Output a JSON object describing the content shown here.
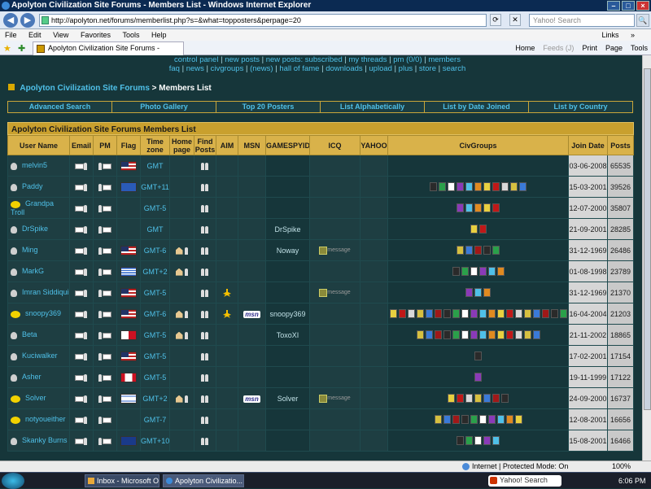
{
  "window": {
    "title": "Apolyton Civilization Site Forums - Members List - Windows Internet Explorer",
    "controls": {
      "minimize": "–",
      "maximize": "□",
      "close": "×"
    }
  },
  "addressbar": {
    "back": "◀",
    "forward": "▶",
    "url": "http://apolyton.net/forums/memberlist.php?s=&what=topposters&perpage=20",
    "refresh": "⟳",
    "stop": "✕",
    "search_placeholder": "Yahoo! Search",
    "search_go": "🔍"
  },
  "menubar": {
    "items": [
      "File",
      "Edit",
      "View",
      "Favorites",
      "Tools",
      "Help"
    ],
    "links": "Links",
    "links_arrow": "»"
  },
  "favbar": {
    "fav_star": "★",
    "add_fav": "✚",
    "tab_title": "Apolyton Civilization Site Forums - Members List",
    "tools": [
      "Home",
      "Feeds (J)",
      "Print",
      "Page",
      "Tools"
    ]
  },
  "forum": {
    "top_links_row1": [
      "control panel",
      "new posts",
      "new posts: subscribed",
      "my threads",
      "pm (0/0)",
      "members"
    ],
    "top_links_row2": [
      "faq",
      "news",
      "civgroups",
      "(news)",
      "hall of fame",
      "downloads",
      "upload",
      "plus",
      "store",
      "search"
    ],
    "breadcrumb_site": "Apolyton Civilization Site Forums",
    "breadcrumb_sep": ">",
    "breadcrumb_page": "Members List",
    "subnav": [
      "Advanced Search",
      "Photo Gallery",
      "Top 20 Posters",
      "List Alphabetically",
      "List by Date Joined",
      "List by Country"
    ],
    "table_title": "Apolyton Civilization Site Forums Members List",
    "columns": [
      "User Name",
      "Email",
      "PM",
      "Flag",
      "Time zone",
      "Home page",
      "Find Posts",
      "AIM",
      "MSN",
      "GAMESPYID",
      "ICQ",
      "YAHOO",
      "CivGroups",
      "Join Date",
      "Posts"
    ],
    "msn_label": "msn",
    "icq_label": "message",
    "members": [
      {
        "name": "melvin5",
        "bulb": "grey",
        "flag": "us",
        "tz": "GMT",
        "home": false,
        "aim": false,
        "msn": false,
        "gamespy": "",
        "icq": false,
        "civ": 0,
        "join": "03-06-2008",
        "posts": "65535"
      },
      {
        "name": "Paddy",
        "bulb": "grey",
        "flag": "sco",
        "tz": "GMT+11",
        "home": false,
        "aim": false,
        "msn": false,
        "gamespy": "",
        "icq": false,
        "civ": 11,
        "join": "15-03-2001",
        "posts": "39526"
      },
      {
        "name": "Grandpa Troll",
        "bulb": "yellow",
        "flag": "",
        "tz": "GMT-5",
        "home": false,
        "aim": false,
        "msn": false,
        "gamespy": "",
        "icq": false,
        "civ": 5,
        "join": "12-07-2000",
        "posts": "35807"
      },
      {
        "name": "DrSpike",
        "bulb": "grey",
        "flag": "",
        "tz": "GMT",
        "home": false,
        "aim": false,
        "msn": false,
        "gamespy": "DrSpike",
        "icq": false,
        "civ": 2,
        "join": "21-09-2001",
        "posts": "28285"
      },
      {
        "name": "Ming",
        "bulb": "grey",
        "flag": "us",
        "tz": "GMT-6",
        "home": true,
        "aim": false,
        "msn": false,
        "gamespy": "Noway",
        "icq": true,
        "civ": 5,
        "join": "31-12-1969",
        "posts": "26486"
      },
      {
        "name": "MarkG",
        "bulb": "grey",
        "flag": "gr",
        "tz": "GMT+2",
        "home": true,
        "aim": false,
        "msn": false,
        "gamespy": "",
        "icq": false,
        "civ": 6,
        "join": "01-08-1998",
        "posts": "23789"
      },
      {
        "name": "Imran Siddiqui",
        "bulb": "grey",
        "flag": "us",
        "tz": "GMT-5",
        "home": false,
        "aim": true,
        "msn": false,
        "gamespy": "",
        "icq": true,
        "civ": 3,
        "join": "31-12-1969",
        "posts": "21370"
      },
      {
        "name": "snoopy369",
        "bulb": "yellow",
        "flag": "us",
        "tz": "GMT-6",
        "home": true,
        "aim": true,
        "msn": true,
        "gamespy": "snoopy369",
        "icq": false,
        "civ": 20,
        "join": "16-04-2004",
        "posts": "21203"
      },
      {
        "name": "Beta",
        "bulb": "grey",
        "flag": "mt",
        "tz": "GMT-5",
        "home": true,
        "aim": false,
        "msn": false,
        "gamespy": "ToxoXI",
        "icq": false,
        "civ": 14,
        "join": "21-11-2002",
        "posts": "18865"
      },
      {
        "name": "Kuciwalker",
        "bulb": "grey",
        "flag": "us",
        "tz": "GMT-5",
        "home": false,
        "aim": false,
        "msn": false,
        "gamespy": "",
        "icq": false,
        "civ": 1,
        "join": "17-02-2001",
        "posts": "17154"
      },
      {
        "name": "Asher",
        "bulb": "grey",
        "flag": "ca",
        "tz": "GMT-5",
        "home": false,
        "aim": false,
        "msn": false,
        "gamespy": "",
        "icq": false,
        "civ": 1,
        "join": "19-11-1999",
        "posts": "17122"
      },
      {
        "name": "Solver",
        "bulb": "yellow",
        "flag": "il",
        "tz": "GMT+2",
        "home": true,
        "aim": false,
        "msn": true,
        "gamespy": "Solver",
        "icq": true,
        "civ": 7,
        "join": "24-09-2000",
        "posts": "16737"
      },
      {
        "name": "notyoueither",
        "bulb": "yellow",
        "flag": "",
        "tz": "GMT-7",
        "home": false,
        "aim": false,
        "msn": false,
        "gamespy": "",
        "icq": false,
        "civ": 10,
        "join": "12-08-2001",
        "posts": "16656"
      },
      {
        "name": "Skanky Burns",
        "bulb": "grey",
        "flag": "au",
        "tz": "GMT+10",
        "home": false,
        "aim": false,
        "msn": false,
        "gamespy": "",
        "icq": false,
        "civ": 5,
        "join": "15-08-2001",
        "posts": "16466"
      }
    ]
  },
  "statusbar": {
    "zone": "Internet | Protected Mode: On",
    "zoom": "100%"
  },
  "taskbar": {
    "tasks": [
      "Inbox - Microsoft O...",
      "Apolyton Civilizatio..."
    ],
    "search": "Yahoo! Search",
    "clock": "6:06 PM"
  },
  "colors": {
    "page_bg": "#16363a",
    "link": "#4fc0e8",
    "header_gold": "#d9b24a"
  }
}
